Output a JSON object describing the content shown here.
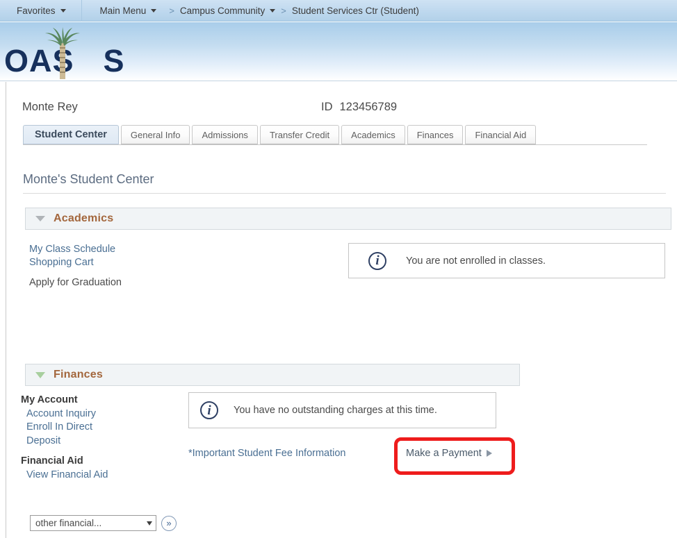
{
  "breadcrumb": {
    "favorites": "Favorites",
    "main_menu": "Main Menu",
    "sep": ">",
    "campus_community": "Campus Community",
    "current": "Student Services Ctr (Student)"
  },
  "branding": {
    "logo_text_left": "OAS",
    "logo_text_right": "S",
    "logo_alt": "OASIS",
    "navy": "#16305c"
  },
  "student": {
    "name": "Monte Rey",
    "id_label": "ID",
    "id_value": "123456789"
  },
  "tabs": [
    {
      "label": "Student Center",
      "active": true
    },
    {
      "label": "General Info",
      "active": false
    },
    {
      "label": "Admissions",
      "active": false
    },
    {
      "label": "Transfer Credit",
      "active": false
    },
    {
      "label": "Academics",
      "active": false
    },
    {
      "label": "Finances",
      "active": false
    },
    {
      "label": "Financial Aid",
      "active": false
    }
  ],
  "page_title": "Monte's Student Center",
  "academics": {
    "section_title": "Academics",
    "links": [
      "My Class Schedule",
      "Shopping Cart",
      "Apply for Graduation"
    ],
    "info_message": "You are not enrolled in classes.",
    "info_icon": "info-circle-icon"
  },
  "finances": {
    "section_title": "Finances",
    "my_account_header": "My Account",
    "my_account_links": [
      "Account Inquiry",
      "Enroll In Direct",
      "Deposit"
    ],
    "financial_aid_header": "Financial Aid",
    "financial_aid_links": [
      "View Financial Aid"
    ],
    "info_message": "You have no outstanding charges at this time.",
    "info_icon": "info-circle-icon",
    "fee_info_link": "*Important Student Fee Information",
    "make_payment_link": "Make a Payment",
    "dropdown_value": "other financial...",
    "go_button": "»"
  },
  "annotation": {
    "highlight_target": "Make a Payment",
    "color": "#ee1c1c"
  }
}
